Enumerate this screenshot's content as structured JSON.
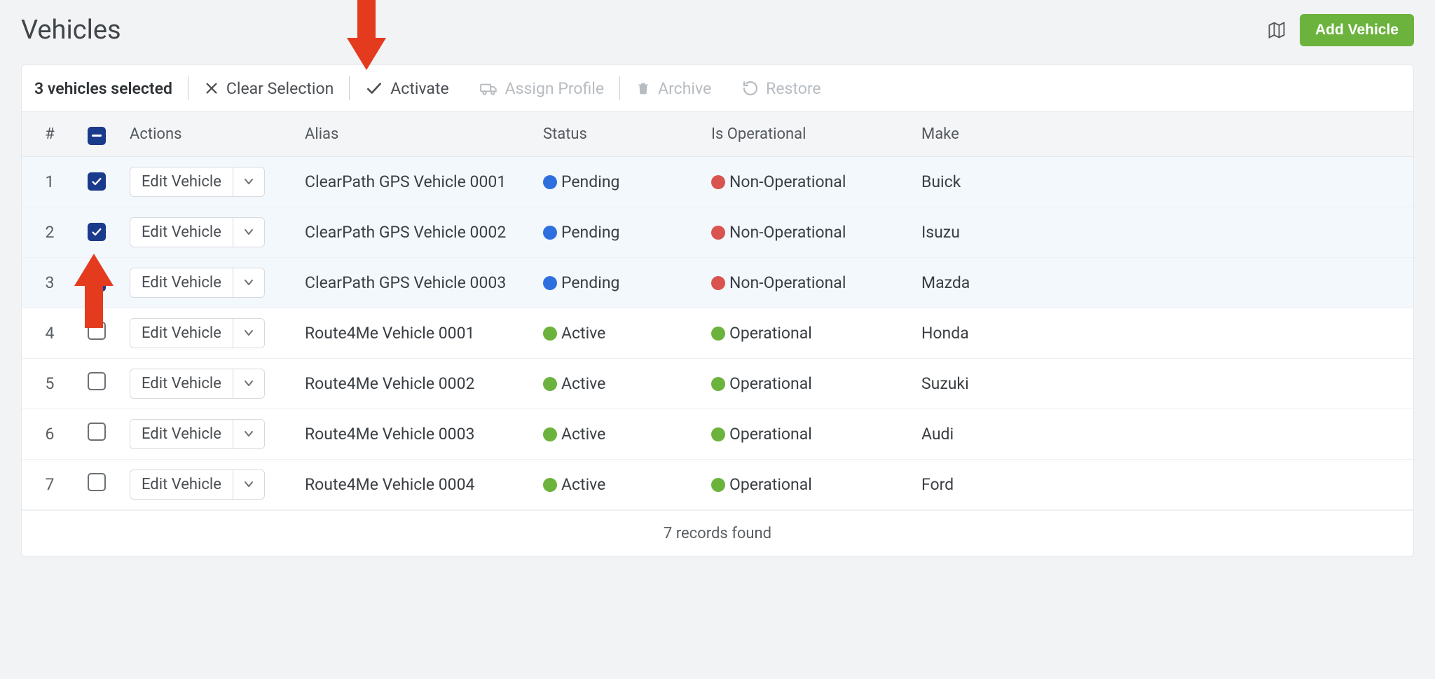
{
  "header": {
    "title": "Vehicles",
    "add_button": "Add Vehicle"
  },
  "toolbar": {
    "selected_text": "3 vehicles selected",
    "clear": "Clear Selection",
    "activate": "Activate",
    "assign_profile": "Assign Profile",
    "archive": "Archive",
    "restore": "Restore"
  },
  "columns": {
    "num": "#",
    "actions": "Actions",
    "alias": "Alias",
    "status": "Status",
    "is_operational": "Is Operational",
    "make": "Make"
  },
  "action_button_label": "Edit Vehicle",
  "rows": [
    {
      "num": "1",
      "checked": true,
      "alias": "ClearPath GPS Vehicle 0001",
      "status": "Pending",
      "status_color": "blue",
      "operational": "Non-Operational",
      "op_color": "red",
      "make": "Buick"
    },
    {
      "num": "2",
      "checked": true,
      "alias": "ClearPath GPS Vehicle 0002",
      "status": "Pending",
      "status_color": "blue",
      "operational": "Non-Operational",
      "op_color": "red",
      "make": "Isuzu"
    },
    {
      "num": "3",
      "checked": true,
      "alias": "ClearPath GPS Vehicle 0003",
      "status": "Pending",
      "status_color": "blue",
      "operational": "Non-Operational",
      "op_color": "red",
      "make": "Mazda"
    },
    {
      "num": "4",
      "checked": false,
      "alias": "Route4Me Vehicle 0001",
      "status": "Active",
      "status_color": "green",
      "operational": "Operational",
      "op_color": "green",
      "make": "Honda"
    },
    {
      "num": "5",
      "checked": false,
      "alias": "Route4Me Vehicle 0002",
      "status": "Active",
      "status_color": "green",
      "operational": "Operational",
      "op_color": "green",
      "make": "Suzuki"
    },
    {
      "num": "6",
      "checked": false,
      "alias": "Route4Me Vehicle 0003",
      "status": "Active",
      "status_color": "green",
      "operational": "Operational",
      "op_color": "green",
      "make": "Audi"
    },
    {
      "num": "7",
      "checked": false,
      "alias": "Route4Me Vehicle 0004",
      "status": "Active",
      "status_color": "green",
      "operational": "Operational",
      "op_color": "green",
      "make": "Ford"
    }
  ],
  "footer": {
    "records_text": "7 records found"
  },
  "annotations": {
    "arrow_top": {
      "target": "activate-button"
    },
    "arrow_bottom": {
      "target": "row-3-checkbox"
    }
  }
}
